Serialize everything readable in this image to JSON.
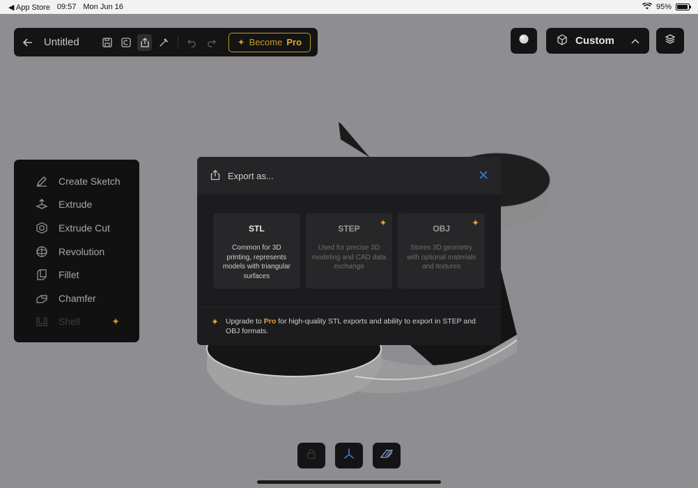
{
  "status": {
    "back_app": "App Store",
    "time": "09:57",
    "date": "Mon Jun 16",
    "battery": "95%",
    "battery_level": 0.95
  },
  "toolbar": {
    "title": "Untitled",
    "become": "Become",
    "pro": "Pro"
  },
  "top_right": {
    "mode_label": "Custom"
  },
  "tools": [
    {
      "label": "Create Sketch",
      "icon": "pencil-icon",
      "enabled": true
    },
    {
      "label": "Extrude",
      "icon": "extrude-icon",
      "enabled": true
    },
    {
      "label": "Extrude Cut",
      "icon": "extrude-cut-icon",
      "enabled": true
    },
    {
      "label": "Revolution",
      "icon": "revolution-icon",
      "enabled": true
    },
    {
      "label": "Fillet",
      "icon": "fillet-icon",
      "enabled": true
    },
    {
      "label": "Chamfer",
      "icon": "chamfer-icon",
      "enabled": true
    },
    {
      "label": "Shell",
      "icon": "shell-icon",
      "enabled": false,
      "pro": true
    }
  ],
  "export_modal": {
    "title": "Export as...",
    "formats": [
      {
        "name": "STL",
        "desc": "Common for 3D printing, represents models with triangular surfaces",
        "locked": false
      },
      {
        "name": "STEP",
        "desc": "Used for precise 3D modeling and CAD data exchange",
        "locked": true
      },
      {
        "name": "OBJ",
        "desc": "Stores 3D geometry with optional materials and textures",
        "locked": true
      }
    ],
    "footer_pre": "Upgrade to ",
    "footer_pro": "Pro",
    "footer_post": " for high-quality STL exports and ability to export in STEP and OBJ formats."
  },
  "colors": {
    "background": "#8e8e92",
    "panel": "#141414",
    "accent_gold": "#e0a82e",
    "accent_blue": "#3f7fd8"
  }
}
